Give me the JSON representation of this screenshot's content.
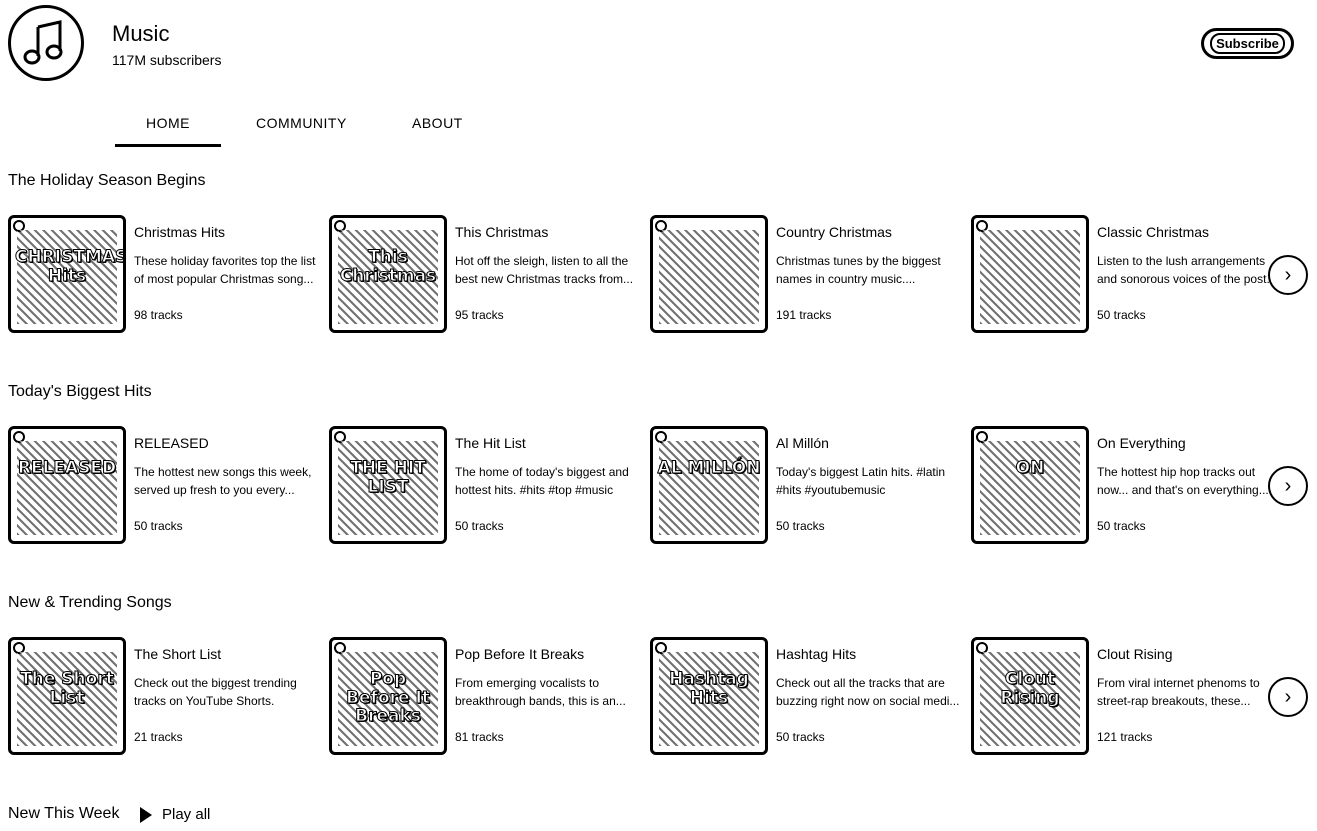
{
  "channel": {
    "name": "Music",
    "subscribers": "117M subscribers",
    "subscribe_label": "Subscribe"
  },
  "tabs": [
    {
      "label": "HOME"
    },
    {
      "label": "COMMUNITY"
    },
    {
      "label": "ABOUT"
    }
  ],
  "sections": [
    {
      "title": "The Holiday Season Begins",
      "cards": [
        {
          "title": "Christmas Hits",
          "desc": "These holiday favorites top the list of most popular Christmas song...",
          "tracks": "98 tracks",
          "thumb_text": "CHRISTMAS Hits"
        },
        {
          "title": "This Christmas",
          "desc": "Hot off the sleigh, listen to all the best new Christmas tracks from...",
          "tracks": "95 tracks",
          "thumb_text": "This Christmas"
        },
        {
          "title": "Country Christmas",
          "desc": "Christmas tunes by the biggest names in country music....",
          "tracks": "191 tracks",
          "thumb_text": ""
        },
        {
          "title": "Classic Christmas",
          "desc": "Listen to the lush arrangements and sonorous voices of the post...",
          "tracks": "50 tracks",
          "thumb_text": ""
        }
      ]
    },
    {
      "title": "Today's Biggest Hits",
      "cards": [
        {
          "title": "RELEASED",
          "desc": "The hottest new songs this week, served up fresh to you every...",
          "tracks": "50 tracks",
          "thumb_text": "RELEASED"
        },
        {
          "title": "The Hit List",
          "desc": "The home of today's biggest and hottest hits. #hits #top #music",
          "tracks": "50 tracks",
          "thumb_text": "THE HIT LIST"
        },
        {
          "title": "Al Millón",
          "desc": "Today's biggest Latin hits. #latin #hits #youtubemusic",
          "tracks": "50 tracks",
          "thumb_text": "AL MILLÓN"
        },
        {
          "title": "On Everything",
          "desc": "The hottest hip hop tracks out now... and that's on everything....",
          "tracks": "50 tracks",
          "thumb_text": "ON"
        }
      ]
    },
    {
      "title": "New & Trending Songs",
      "cards": [
        {
          "title": "The Short List",
          "desc": "Check out the biggest trending tracks on YouTube Shorts.",
          "tracks": "21 tracks",
          "thumb_text": "The Short List"
        },
        {
          "title": "Pop Before It Breaks",
          "desc": "From emerging vocalists to breakthrough bands, this is an...",
          "tracks": "81 tracks",
          "thumb_text": "Pop Before It Breaks"
        },
        {
          "title": "Hashtag Hits",
          "desc": "Check out all the tracks that are buzzing right now on social medi...",
          "tracks": "50 tracks",
          "thumb_text": "Hashtag Hits"
        },
        {
          "title": "Clout Rising",
          "desc": "From viral internet phenoms to street-rap breakouts, these...",
          "tracks": "121 tracks",
          "thumb_text": "Clout Rising"
        }
      ]
    }
  ],
  "new_this_week": {
    "title": "New This Week",
    "play_all_label": "Play all"
  }
}
